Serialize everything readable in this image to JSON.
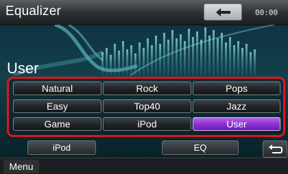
{
  "title_bar": {
    "title": "Equalizer",
    "back_icon": "back-arrow-icon",
    "clock": "00:00"
  },
  "mode_label": "User",
  "presets": [
    {
      "label": "Natural",
      "selected": false
    },
    {
      "label": "Rock",
      "selected": false
    },
    {
      "label": "Pops",
      "selected": false
    },
    {
      "label": "Easy",
      "selected": false
    },
    {
      "label": "Top40",
      "selected": false
    },
    {
      "label": "Jazz",
      "selected": false
    },
    {
      "label": "Game",
      "selected": false
    },
    {
      "label": "iPod",
      "selected": false
    },
    {
      "label": "User",
      "selected": true
    }
  ],
  "tabs": {
    "ipod": "iPod",
    "eq": "EQ",
    "return_icon": "return-icon"
  },
  "status_bar": {
    "menu": "Menu"
  },
  "colors": {
    "highlight_border": "#e0151a",
    "selected_preset": "#8a2fd0",
    "art_accent": "#6fd6dc"
  }
}
